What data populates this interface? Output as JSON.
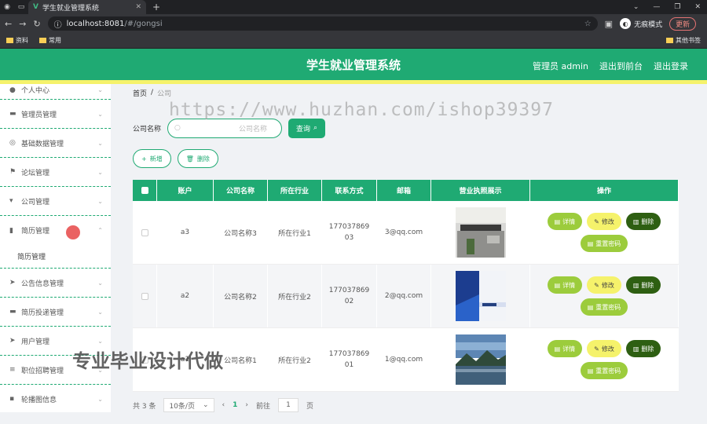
{
  "browser": {
    "tab_title": "学生就业管理系统",
    "url_host": "localhost:8081",
    "url_path": "/#/gongsi",
    "incognito_label": "无痕模式",
    "update_label": "更新",
    "bookmarks": [
      "资料",
      "常用"
    ],
    "other_bookmarks": "其他书签"
  },
  "header": {
    "title": "学生就业管理系统",
    "admin_label": "管理员 admin",
    "back_label": "退出到前台",
    "logout_label": "退出登录",
    "accent_color": "#1faa73",
    "strip_color": "#f5f26b"
  },
  "sidebar": {
    "items": [
      {
        "label": "个人中心",
        "icon": "user-icon"
      },
      {
        "label": "管理员管理",
        "icon": "monitor-icon"
      },
      {
        "label": "基础数据管理",
        "icon": "compass-icon"
      },
      {
        "label": "论坛管理",
        "icon": "flag-icon"
      },
      {
        "label": "公司管理",
        "icon": "chair-icon"
      },
      {
        "label": "简历管理",
        "icon": "bar-chart-icon"
      },
      {
        "label": "公告信息管理",
        "icon": "send-icon"
      },
      {
        "label": "简历投递管理",
        "icon": "monitor-icon"
      },
      {
        "label": "用户管理",
        "icon": "send-icon"
      },
      {
        "label": "职位招聘管理",
        "icon": "menu-icon"
      },
      {
        "label": "轮播图信息",
        "icon": "chat-icon"
      }
    ],
    "sub_item": "简历管理"
  },
  "breadcrumb": {
    "home": "首页",
    "sep": "/",
    "current": "公司"
  },
  "watermark": "https://www.huzhan.com/ishop39397",
  "overlay_text": "专业毕业设计代做",
  "search": {
    "label": "公司名称",
    "placeholder": "公司名称",
    "button": "查询"
  },
  "actions": {
    "add": "新增",
    "delete": "删除"
  },
  "table": {
    "headers": [
      "账户",
      "公司名称",
      "所在行业",
      "联系方式",
      "邮箱",
      "营业执照展示",
      "操作"
    ],
    "rows": [
      {
        "account": "a3",
        "company": "公司名称3",
        "industry": "所在行业1",
        "phone": "17703786903",
        "email": "3@qq.com"
      },
      {
        "account": "a2",
        "company": "公司名称2",
        "industry": "所在行业2",
        "phone": "17703786902",
        "email": "2@qq.com"
      },
      {
        "account": "a1",
        "company": "公司名称1",
        "industry": "所在行业2",
        "phone": "17703786901",
        "email": "1@qq.com"
      }
    ],
    "ops": {
      "detail": "详情",
      "edit": "修改",
      "delete": "删除",
      "reset": "重置密码"
    }
  },
  "pagination": {
    "total": "共 3 条",
    "page_size": "10条/页",
    "current": "1",
    "goto_label": "前往",
    "goto_value": "1",
    "page_suffix": "页"
  }
}
